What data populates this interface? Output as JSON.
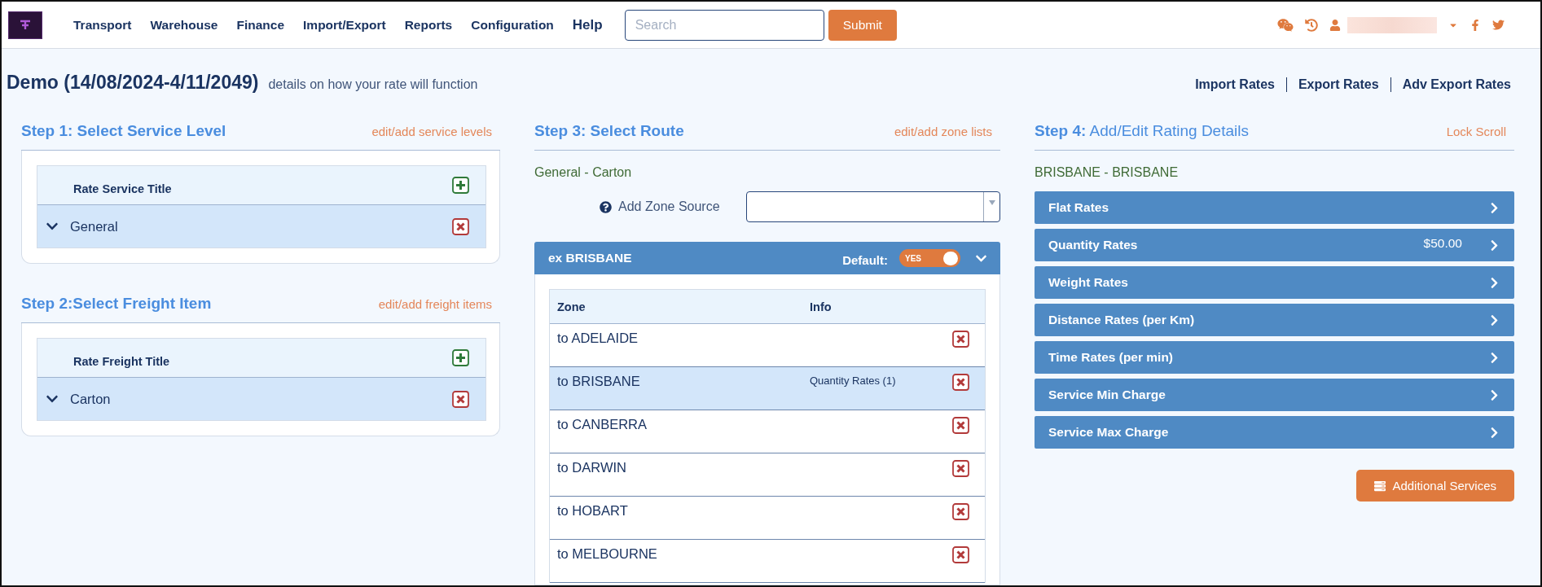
{
  "nav": {
    "items": [
      "Transport",
      "Warehouse",
      "Finance",
      "Import/Export",
      "Reports",
      "Configuration",
      "Help"
    ],
    "search": {
      "placeholder": "Search"
    },
    "submit": "Submit"
  },
  "page": {
    "title": "Demo (14/08/2024-4/11/2049)",
    "subtitle": "details on how your rate will function",
    "links": [
      "Import Rates",
      "Export Rates",
      "Adv Export Rates"
    ]
  },
  "step1": {
    "title": "Step 1: Select Service Level",
    "link": "edit/add service levels",
    "column": "Rate Service Title",
    "rows": [
      {
        "label": "General",
        "selected": true
      }
    ]
  },
  "step2": {
    "title": "Step 2:Select Freight Item",
    "link": "edit/add freight items",
    "column": "Rate Freight Title",
    "rows": [
      {
        "label": "Carton",
        "selected": true
      }
    ]
  },
  "step3": {
    "title": "Step 3: Select Route",
    "link": "edit/add zone lists",
    "selection": "General - Carton",
    "zone_source_label": "Add Zone Source",
    "group": {
      "title": "ex BRISBANE",
      "default_label": "Default:",
      "default_toggle": {
        "label": "YES",
        "on": true
      },
      "columns": [
        "Zone",
        "Info"
      ],
      "rows": [
        {
          "zone": "to ADELAIDE",
          "selected": false
        },
        {
          "zone": "to BRISBANE",
          "info": "Quantity Rates (1)",
          "selected": true
        },
        {
          "zone": "to CANBERRA",
          "selected": false
        },
        {
          "zone": "to DARWIN",
          "selected": false
        },
        {
          "zone": "to HOBART",
          "selected": false
        },
        {
          "zone": "to MELBOURNE",
          "selected": false
        }
      ]
    }
  },
  "step4": {
    "title": "**Step 4:** Add/Edit Rating Details",
    "link": "Lock Scroll",
    "selection": "BRISBANE - BRISBANE",
    "rates": [
      {
        "label": "Flat Rates"
      },
      {
        "label": "Quantity Rates",
        "value": "$50.00"
      },
      {
        "label": "Weight Rates"
      },
      {
        "label": "Distance Rates (per Km)"
      },
      {
        "label": "Time Rates (per min)"
      },
      {
        "label": "Service Min Charge"
      },
      {
        "label": "Service Max Charge"
      }
    ],
    "additional_button": "Additional Services"
  }
}
